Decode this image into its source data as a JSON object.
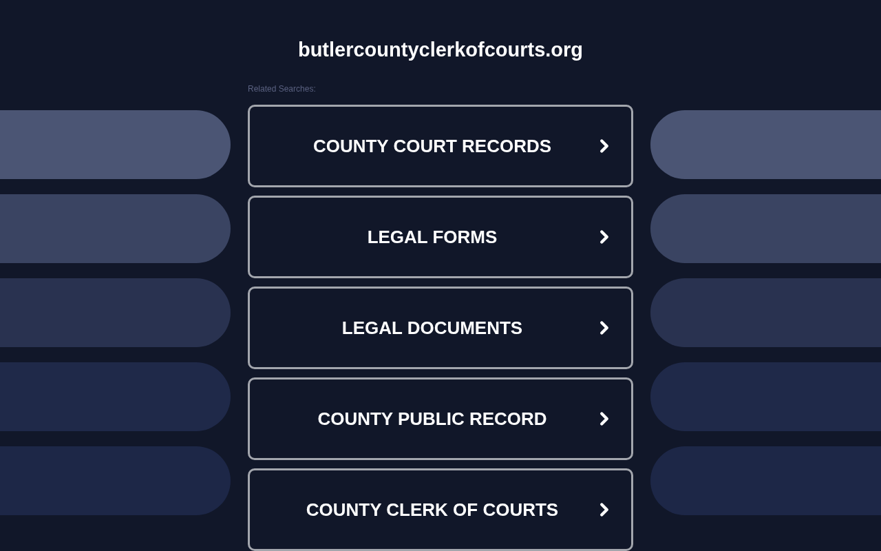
{
  "site_title": "butlercountyclerkofcourts.org",
  "related_label": "Related Searches:",
  "links": [
    {
      "label": "COUNTY COURT RECORDS"
    },
    {
      "label": "LEGAL FORMS"
    },
    {
      "label": "LEGAL DOCUMENTS"
    },
    {
      "label": "COUNTY PUBLIC RECORD"
    },
    {
      "label": "COUNTY CLERK OF COURTS"
    }
  ]
}
